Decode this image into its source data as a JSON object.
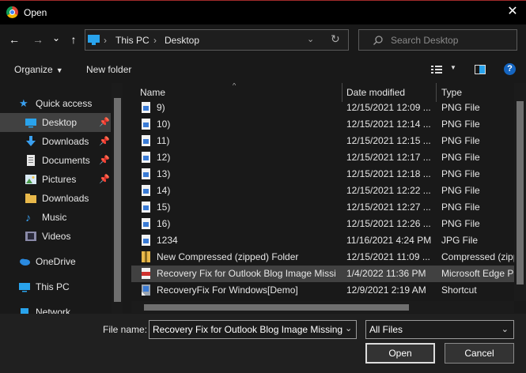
{
  "window": {
    "title": "Open"
  },
  "nav": {
    "back": "←",
    "forward": "→",
    "recent": "⌄",
    "up": "↑"
  },
  "address": {
    "crumbs": [
      "This PC",
      "Desktop"
    ],
    "sep": "›",
    "refresh": "↻"
  },
  "search": {
    "placeholder": "Search Desktop"
  },
  "toolbar": {
    "organize": "Organize",
    "new_folder": "New folder"
  },
  "sidebar": {
    "items": [
      {
        "label": "Quick access",
        "icon": "star-icon"
      },
      {
        "label": "Desktop",
        "icon": "desktop-icon",
        "pinned": true,
        "selected": true
      },
      {
        "label": "Downloads",
        "icon": "download-icon",
        "pinned": true
      },
      {
        "label": "Documents",
        "icon": "document-icon",
        "pinned": true
      },
      {
        "label": "Pictures",
        "icon": "picture-icon",
        "pinned": true
      },
      {
        "label": "Downloads",
        "icon": "folder-icon"
      },
      {
        "label": "Music",
        "icon": "music-icon"
      },
      {
        "label": "Videos",
        "icon": "video-icon"
      },
      {
        "label": "OneDrive",
        "icon": "cloud-icon"
      },
      {
        "label": "This PC",
        "icon": "computer-icon"
      },
      {
        "label": "Network",
        "icon": "network-icon"
      }
    ]
  },
  "columns": {
    "name": "Name",
    "date": "Date modified",
    "type": "Type"
  },
  "files": [
    {
      "name": "9)",
      "date": "12/15/2021 12:09 ...",
      "type": "PNG File"
    },
    {
      "name": "10)",
      "date": "12/15/2021 12:14 ...",
      "type": "PNG File"
    },
    {
      "name": "11)",
      "date": "12/15/2021 12:15 ...",
      "type": "PNG File"
    },
    {
      "name": "12)",
      "date": "12/15/2021 12:17 ...",
      "type": "PNG File"
    },
    {
      "name": "13)",
      "date": "12/15/2021 12:18 ...",
      "type": "PNG File"
    },
    {
      "name": "14)",
      "date": "12/15/2021 12:22 ...",
      "type": "PNG File"
    },
    {
      "name": "15)",
      "date": "12/15/2021 12:27 ...",
      "type": "PNG File"
    },
    {
      "name": "16)",
      "date": "12/15/2021 12:26 ...",
      "type": "PNG File"
    },
    {
      "name": "1234",
      "date": "11/16/2021 4:24 PM",
      "type": "JPG File"
    },
    {
      "name": "New Compressed (zipped) Folder",
      "date": "12/15/2021 11:09 ...",
      "type": "Compressed (zipp"
    },
    {
      "name": "Recovery Fix for Outlook Blog Image Missing",
      "date": "1/4/2022 11:36 PM",
      "type": "Microsoft Edge PDF Document"
    },
    {
      "name": "RecoveryFix For Windows[Demo]",
      "date": "12/9/2021 2:19 AM",
      "type": "Shortcut"
    }
  ],
  "footer": {
    "file_name_label": "File name:",
    "file_name_value": "Recovery Fix for Outlook Blog Image Missing",
    "file_type": "All Files",
    "open": "Open",
    "cancel": "Cancel"
  },
  "colors": {
    "accent": "#0078d7",
    "selection": "#414141",
    "pdf_red": "#d0312d"
  }
}
